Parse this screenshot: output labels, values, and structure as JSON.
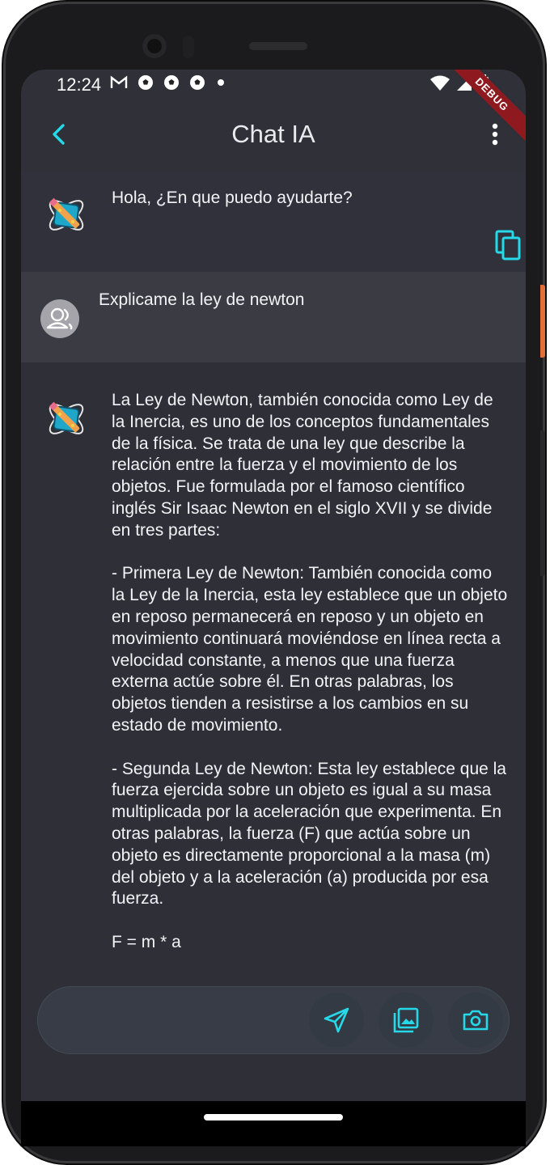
{
  "colors": {
    "accent": "#25d9e9",
    "background": "#2f3038",
    "user_row": "#3a3b43"
  },
  "status": {
    "time": "12:24",
    "left_icons": [
      "gmail-icon",
      "soccer-ball-icon",
      "soccer-ball-icon",
      "soccer-ball-icon",
      "dot-icon"
    ],
    "right_icons": [
      "wifi-icon",
      "signal-icon",
      "battery-icon"
    ],
    "debug_banner": "DEBUG"
  },
  "appbar": {
    "title": "Chat IA",
    "back_icon": "chevron-left-icon",
    "menu_icon": "more-vert-icon"
  },
  "messages": {
    "bot_greeting": "Hola, ¿En que puedo ayudarte?",
    "user_question": "Explicame la ley de newton",
    "bot_answer": "La Ley de Newton, también conocida como Ley de la Inercia, es uno de los conceptos fundamentales de la física. Se trata de una ley que describe la relación entre la fuerza y el movimiento de los objetos. Fue formulada por el famoso científico inglés Sir Isaac Newton en el siglo XVII y se divide en tres partes:\n\n- Primera Ley de Newton: También conocida como la Ley de la Inercia, esta ley establece que un objeto en reposo permanecerá en reposo y un objeto en movimiento continuará moviéndose en línea recta a velocidad constante, a menos que una fuerza externa actúe sobre él. En otras palabras, los objetos tienden a resistirse a los cambios en su estado de movimiento.\n\n- Segunda Ley de Newton: Esta ley establece que la fuerza ejercida sobre un objeto es igual a su masa multiplicada por la aceleración que experimenta. En otras palabras, la fuerza (F) que actúa sobre un objeto es directamente proporcional a la masa (m) del objeto y a la aceleración (a) producida por esa fuerza.\n\nF = m * a"
  },
  "input": {
    "value": "",
    "placeholder": "",
    "buttons": [
      "send-icon",
      "gallery-icon",
      "camera-icon"
    ]
  }
}
